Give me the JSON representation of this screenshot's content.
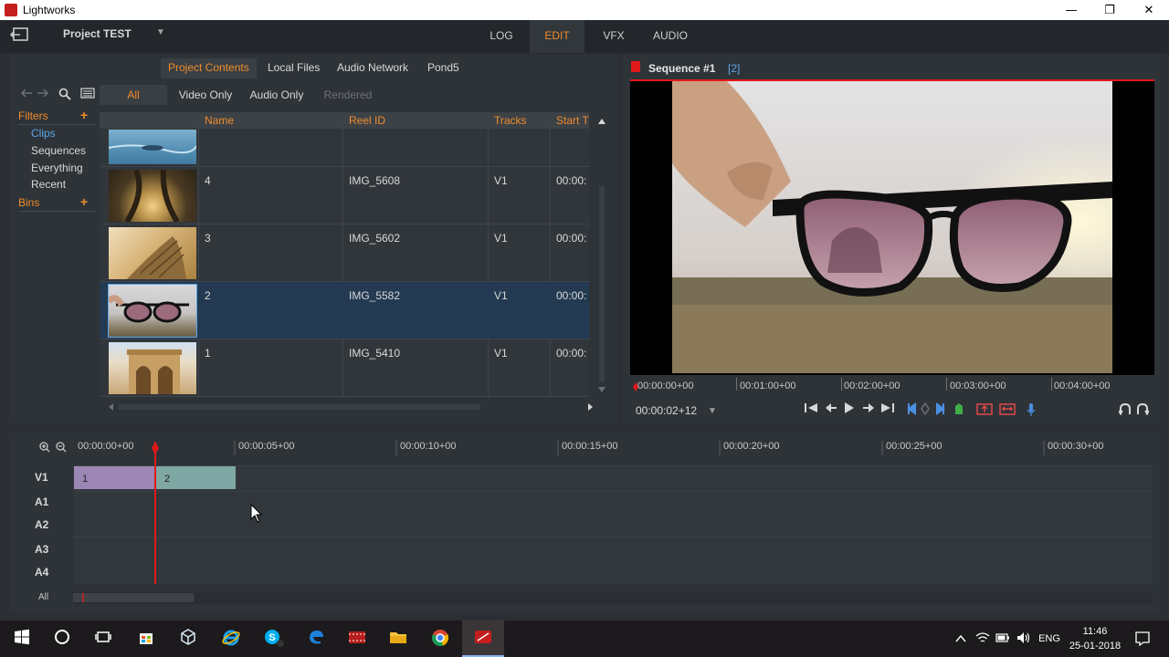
{
  "window": {
    "title": "Lightworks",
    "min": "—",
    "max": "❐",
    "close": "✕"
  },
  "project": {
    "name": "Project TEST",
    "dropdown": "▼"
  },
  "modes": [
    {
      "label": "LOG"
    },
    {
      "label": "EDIT"
    },
    {
      "label": "VFX"
    },
    {
      "label": "AUDIO"
    }
  ],
  "source_tabs": [
    {
      "label": "Project Contents"
    },
    {
      "label": "Local Files"
    },
    {
      "label": "Audio Network"
    },
    {
      "label": "Pond5"
    }
  ],
  "filter_tabs": [
    {
      "label": "All"
    },
    {
      "label": "Video Only"
    },
    {
      "label": "Audio Only"
    },
    {
      "label": "Rendered"
    }
  ],
  "sidebar": {
    "filters": "Filters",
    "bins": "Bins",
    "plus": "+",
    "items": [
      {
        "label": "Clips"
      },
      {
        "label": "Sequences"
      },
      {
        "label": "Everything"
      },
      {
        "label": "Recent"
      }
    ]
  },
  "grid": {
    "headers": {
      "name": "Name",
      "reel": "Reel ID",
      "tracks": "Tracks",
      "start": "Start T"
    },
    "rows": [
      {
        "name": "4",
        "reel": "IMG_5608",
        "tracks": "V1",
        "start": "00:00:"
      },
      {
        "name": "3",
        "reel": "IMG_5602",
        "tracks": "V1",
        "start": "00:00:"
      },
      {
        "name": "2",
        "reel": "IMG_5582",
        "tracks": "V1",
        "start": "00:00:"
      },
      {
        "name": "1",
        "reel": "IMG_5410",
        "tracks": "V1",
        "start": "00:00:"
      }
    ]
  },
  "viewer": {
    "title": "Sequence #1",
    "count": "[2]",
    "ruler": [
      "00:00:00+00",
      "00:01:00+00",
      "00:02:00+00",
      "00:03:00+00",
      "00:04:00+00"
    ],
    "timecode": "00:00:02+12",
    "timecode_dd": "▼"
  },
  "timeline": {
    "ruler": [
      "00:00:00+00",
      "00:00:05+00",
      "00:00:10+00",
      "00:00:15+00",
      "00:00:20+00",
      "00:00:25+00",
      "00:00:30+00"
    ],
    "tracks": [
      "V1",
      "A1",
      "A2",
      "A3",
      "A4"
    ],
    "clips": [
      {
        "label": "1",
        "color": "#9c86b4"
      },
      {
        "label": "2",
        "color": "#7fa7a4"
      }
    ],
    "all_label": "All"
  },
  "tray": {
    "lang": "ENG",
    "time": "11:46",
    "date": "25-01-2018"
  },
  "colors": {
    "accent": "#f08c2c",
    "selection": "#5aa6e8",
    "record": "#e01a1a"
  }
}
